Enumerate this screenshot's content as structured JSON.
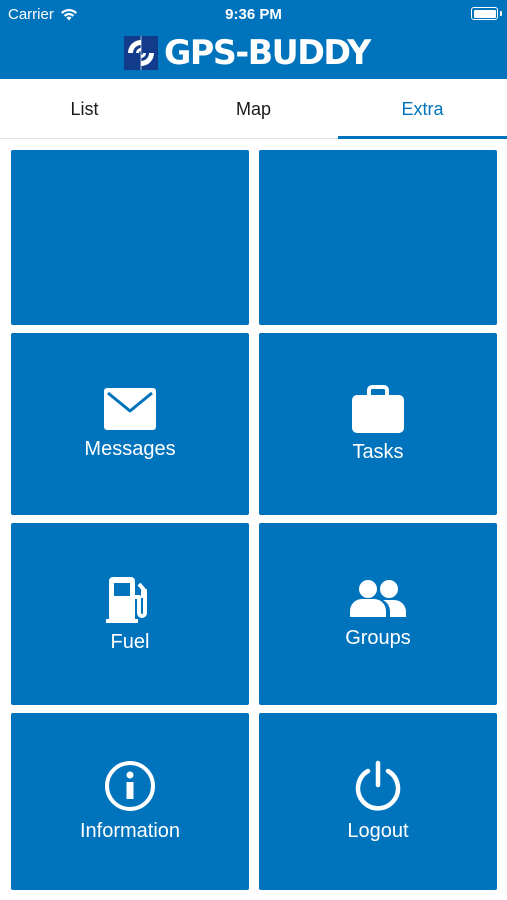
{
  "status_bar": {
    "carrier": "Carrier",
    "time": "9:36 PM"
  },
  "header": {
    "logo_text": "GPS-BUDDY",
    "background": "#0073bd"
  },
  "tabs": [
    {
      "label": "List",
      "active": false
    },
    {
      "label": "Map",
      "active": false
    },
    {
      "label": "Extra",
      "active": true
    }
  ],
  "tiles": [
    {
      "label": "",
      "icon": ""
    },
    {
      "label": "",
      "icon": ""
    },
    {
      "label": "Messages",
      "icon": "envelope-icon"
    },
    {
      "label": "Tasks",
      "icon": "briefcase-icon"
    },
    {
      "label": "Fuel",
      "icon": "fuel-pump-icon"
    },
    {
      "label": "Groups",
      "icon": "users-icon"
    },
    {
      "label": "Information",
      "icon": "info-icon"
    },
    {
      "label": "Logout",
      "icon": "power-icon"
    }
  ],
  "colors": {
    "primary": "#0073bd",
    "text": "#1a1a1a",
    "white": "#ffffff"
  }
}
